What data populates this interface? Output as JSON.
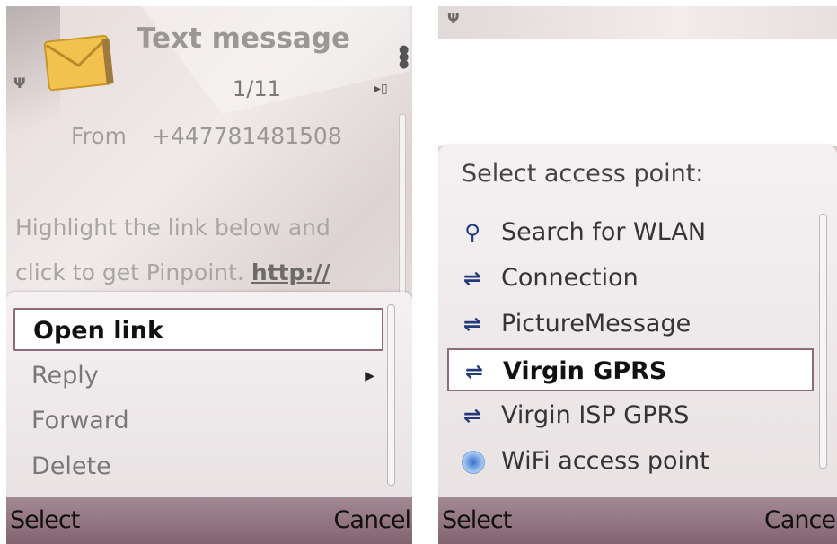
{
  "left": {
    "title": "Text message",
    "count": "1/11",
    "from_label": "From",
    "from_number": "+447781481508",
    "body_line1": "Highlight the link below and",
    "body_line2_text": "click to get Pinpoint. ",
    "body_link": "http://",
    "menu": [
      "Open link",
      "Reply",
      "Forward",
      "Delete"
    ],
    "softkey_left": "Select",
    "softkey_right": "Cancel"
  },
  "right": {
    "heading": "Select access point:",
    "items": [
      {
        "label": "Search for WLAN",
        "icon": "search-wlan-icon"
      },
      {
        "label": "Connection",
        "icon": "connection-icon"
      },
      {
        "label": "PictureMessage",
        "icon": "connection-icon"
      },
      {
        "label": "Virgin GPRS",
        "icon": "connection-icon"
      },
      {
        "label": "Virgin ISP GPRS",
        "icon": "connection-icon"
      },
      {
        "label": "WiFi access point",
        "icon": "wifi-icon"
      }
    ],
    "softkey_left": "Select",
    "softkey_right": "Cance"
  },
  "colors": {
    "softbar": "#8f707c",
    "selection_border": "#8d6b78"
  }
}
